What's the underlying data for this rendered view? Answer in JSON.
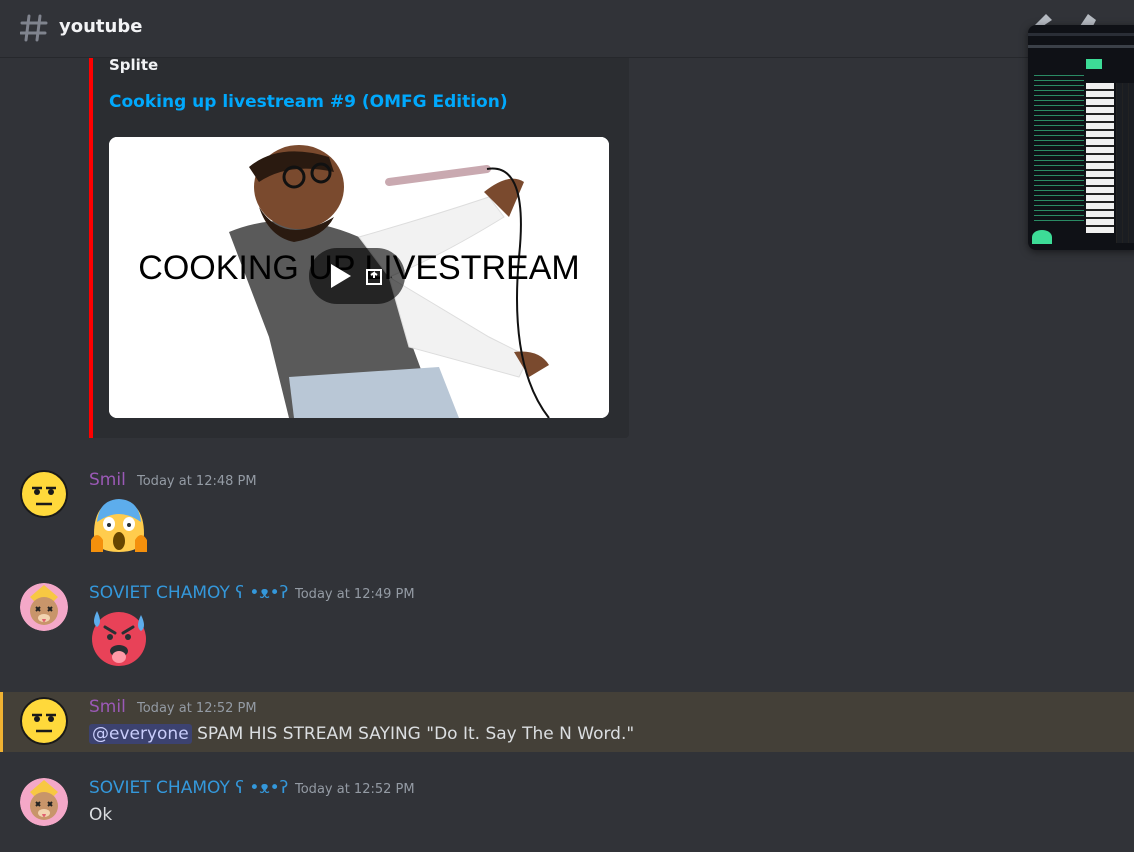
{
  "channel": {
    "name": "youtube",
    "icon": "hash-icon"
  },
  "embed": {
    "provider": "Splite",
    "title": "Cooking up livestream #9 (OMFG Edition)",
    "thumbnail_text": "COOKING UP LIVESTREAM",
    "accent_color": "#ff0000"
  },
  "messages": [
    {
      "author": "Smil",
      "author_color": "#9b59b6",
      "time": "Today at 12:48 PM",
      "emoji": "face-screaming-in-fear"
    },
    {
      "author": "SOVIET CHAMOY ʕ •ᴥ•ʔ",
      "author_color": "#3498db",
      "time": "Today at 12:49 PM",
      "emoji": "hot-face-sweat"
    },
    {
      "author": "Smil",
      "author_color": "#9b59b6",
      "time": "Today at 12:52 PM",
      "mention": "@everyone",
      "text": " SPAM HIS STREAM SAYING \"Do It. Say The N Word.\""
    },
    {
      "author": "SOVIET CHAMOY ʕ •ᴥ•ʔ",
      "author_color": "#3498db",
      "time": "Today at 12:52 PM",
      "text": "Ok"
    }
  ]
}
